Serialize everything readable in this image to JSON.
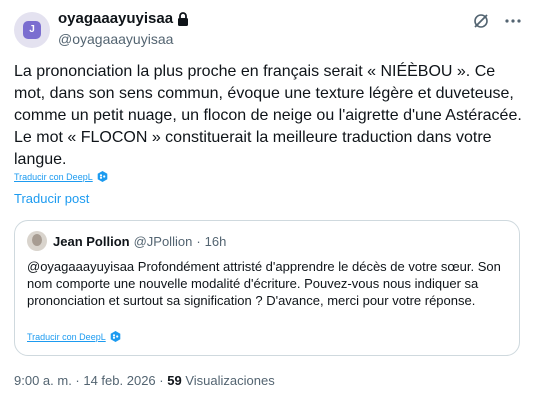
{
  "author": {
    "display_name": "oyagaaayuyisaa",
    "handle": "@oyagaaayuyisaa"
  },
  "tweet": {
    "text": "La prononciation la plus proche en français serait « NIÉÈBOU ». Ce mot, dans son sens commun, évoque une texture légère et duveteuse, comme un petit nuage, un flocon de neige ou l'aigrette d'une Astéracée. Le mot « FLOCON » constituerait la meilleure traduction dans votre langue.",
    "deepl_label": "Traducir con DeepL",
    "translate_label": "Traducir post"
  },
  "quote": {
    "display_name": "Jean Pollion",
    "handle": "@JPollion",
    "separator": "·",
    "time": "16h",
    "text": "@oyagaaayuyisaa Profondément attristé d'apprendre le décès de votre sœur. Son nom comporte une nouvelle modalité d'écriture. Pouvez-vous nous indiquer sa prononciation et surtout sa signification ? D'avance, merci pour votre réponse.",
    "deepl_label": "Traducir con DeepL"
  },
  "footer": {
    "datetime": "9:00 a. m. · 14 feb. 2026",
    "separator": "·",
    "views_count": "59",
    "views_label": "Visualizaciones"
  },
  "icons": {
    "lock": "lock-icon",
    "grok": "grok-icon",
    "more": "more-icon",
    "deepl": "deepl-badge-icon"
  },
  "colors": {
    "link": "#1d9bf0",
    "muted": "#536471",
    "border": "#cfd9de"
  }
}
